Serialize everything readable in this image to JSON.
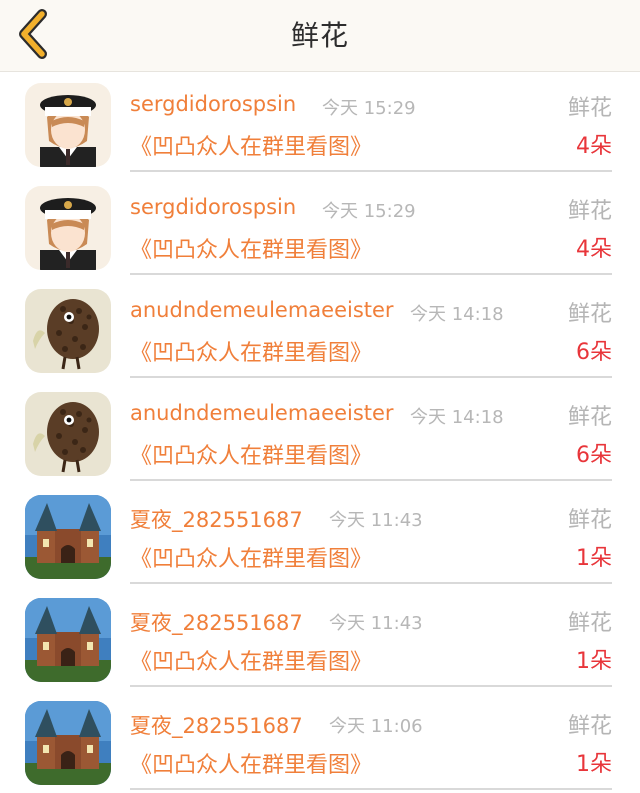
{
  "header": {
    "title": "鲜花"
  },
  "icons": {
    "back": "chevron-left-icon"
  },
  "colors": {
    "accent": "#f07f3a",
    "count": "#e8353a",
    "muted": "#b7b7b7",
    "back_icon": "#f2b02c"
  },
  "items": [
    {
      "avatar": "sailor-boy-avatar",
      "name": "sergdidorospsin",
      "time": "今天 15:29",
      "gift": "鲜花",
      "group": "《凹凸众人在群里看图》",
      "count": "4朵"
    },
    {
      "avatar": "sailor-boy-avatar",
      "name": "sergdidorospsin",
      "time": "今天 15:29",
      "gift": "鲜花",
      "group": "《凹凸众人在群里看图》",
      "count": "4朵"
    },
    {
      "avatar": "hedgehog-avatar",
      "name": "anudndemeulemaeeister",
      "time": "今天 14:18",
      "gift": "鲜花",
      "group": "《凹凸众人在群里看图》",
      "count": "6朵"
    },
    {
      "avatar": "hedgehog-avatar",
      "name": "anudndemeulemaeeister",
      "time": "今天 14:18",
      "gift": "鲜花",
      "group": "《凹凸众人在群里看图》",
      "count": "6朵"
    },
    {
      "avatar": "castle-avatar",
      "name": "夏夜_282551687",
      "time": "今天 11:43",
      "gift": "鲜花",
      "group": "《凹凸众人在群里看图》",
      "count": "1朵"
    },
    {
      "avatar": "castle-avatar",
      "name": "夏夜_282551687",
      "time": "今天 11:43",
      "gift": "鲜花",
      "group": "《凹凸众人在群里看图》",
      "count": "1朵"
    },
    {
      "avatar": "castle-avatar",
      "name": "夏夜_282551687",
      "time": "今天 11:06",
      "gift": "鲜花",
      "group": "《凹凸众人在群里看图》",
      "count": "1朵"
    }
  ]
}
